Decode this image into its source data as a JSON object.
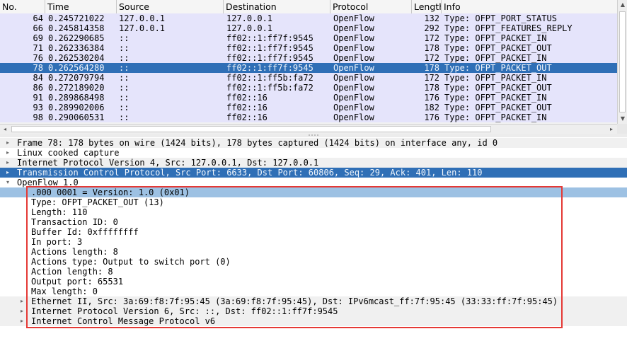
{
  "packet_list": {
    "columns": [
      "No.",
      "Time",
      "Source",
      "Destination",
      "Protocol",
      "Length",
      "Info"
    ],
    "rows": [
      {
        "no": "64",
        "time": "0.245721022",
        "src": "127.0.0.1",
        "dst": "127.0.0.1",
        "proto": "OpenFlow",
        "len": "132",
        "info": "Type: OFPT_PORT_STATUS",
        "selected": false
      },
      {
        "no": "66",
        "time": "0.245814358",
        "src": "127.0.0.1",
        "dst": "127.0.0.1",
        "proto": "OpenFlow",
        "len": "292",
        "info": "Type: OFPT_FEATURES_REPLY",
        "selected": false
      },
      {
        "no": "69",
        "time": "0.262290685",
        "src": "::",
        "dst": "ff02::1:ff7f:9545",
        "proto": "OpenFlow",
        "len": "172",
        "info": "Type: OFPT_PACKET_IN",
        "selected": false
      },
      {
        "no": "71",
        "time": "0.262336384",
        "src": "::",
        "dst": "ff02::1:ff7f:9545",
        "proto": "OpenFlow",
        "len": "178",
        "info": "Type: OFPT_PACKET_OUT",
        "selected": false
      },
      {
        "no": "76",
        "time": "0.262530204",
        "src": "::",
        "dst": "ff02::1:ff7f:9545",
        "proto": "OpenFlow",
        "len": "172",
        "info": "Type: OFPT_PACKET_IN",
        "selected": false
      },
      {
        "no": "78",
        "time": "0.262564280",
        "src": "::",
        "dst": "ff02::1:ff7f:9545",
        "proto": "OpenFlow",
        "len": "178",
        "info": "Type: OFPT_PACKET_OUT",
        "selected": true
      },
      {
        "no": "84",
        "time": "0.272079794",
        "src": "::",
        "dst": "ff02::1:ff5b:fa72",
        "proto": "OpenFlow",
        "len": "172",
        "info": "Type: OFPT_PACKET_IN",
        "selected": false
      },
      {
        "no": "86",
        "time": "0.272189020",
        "src": "::",
        "dst": "ff02::1:ff5b:fa72",
        "proto": "OpenFlow",
        "len": "178",
        "info": "Type: OFPT_PACKET_OUT",
        "selected": false
      },
      {
        "no": "91",
        "time": "0.289868498",
        "src": "::",
        "dst": "ff02::16",
        "proto": "OpenFlow",
        "len": "176",
        "info": "Type: OFPT_PACKET_IN",
        "selected": false
      },
      {
        "no": "93",
        "time": "0.289902006",
        "src": "::",
        "dst": "ff02::16",
        "proto": "OpenFlow",
        "len": "182",
        "info": "Type: OFPT_PACKET_OUT",
        "selected": false
      },
      {
        "no": "98",
        "time": "0.290060531",
        "src": "::",
        "dst": "ff02::16",
        "proto": "OpenFlow",
        "len": "176",
        "info": "Type: OFPT_PACKET_IN",
        "selected": false
      }
    ]
  },
  "details": [
    {
      "text": "Frame 78: 178 bytes on wire (1424 bits), 178 bytes captured (1424 bits) on interface any, id 0",
      "level": 0,
      "expander": "collapsed",
      "style": "alt"
    },
    {
      "text": "Linux cooked capture",
      "level": 0,
      "expander": "collapsed",
      "style": "plain"
    },
    {
      "text": "Internet Protocol Version 4, Src: 127.0.0.1, Dst: 127.0.0.1",
      "level": 0,
      "expander": "collapsed",
      "style": "alt"
    },
    {
      "text": "Transmission Control Protocol, Src Port: 6633, Dst Port: 60806, Seq: 29, Ack: 401, Len: 110",
      "level": 0,
      "expander": "collapsed",
      "style": "sel"
    },
    {
      "text": "OpenFlow 1.0",
      "level": 0,
      "expander": "expanded",
      "style": "plain"
    },
    {
      "text": ".000 0001 = Version: 1.0 (0x01)",
      "level": 1,
      "expander": "none",
      "style": "subsel"
    },
    {
      "text": "Type: OFPT_PACKET_OUT (13)",
      "level": 1,
      "expander": "none",
      "style": "sub"
    },
    {
      "text": "Length: 110",
      "level": 1,
      "expander": "none",
      "style": "sub"
    },
    {
      "text": "Transaction ID: 0",
      "level": 1,
      "expander": "none",
      "style": "sub"
    },
    {
      "text": "Buffer Id: 0xffffffff",
      "level": 1,
      "expander": "none",
      "style": "sub"
    },
    {
      "text": "In port: 3",
      "level": 1,
      "expander": "none",
      "style": "sub"
    },
    {
      "text": "Actions length: 8",
      "level": 1,
      "expander": "none",
      "style": "sub"
    },
    {
      "text": "Actions type: Output to switch port (0)",
      "level": 1,
      "expander": "none",
      "style": "sub"
    },
    {
      "text": "Action length: 8",
      "level": 1,
      "expander": "none",
      "style": "sub"
    },
    {
      "text": "Output port: 65531",
      "level": 1,
      "expander": "none",
      "style": "sub"
    },
    {
      "text": "Max length: 0",
      "level": 1,
      "expander": "none",
      "style": "sub"
    },
    {
      "text": "Ethernet II, Src: 3a:69:f8:7f:95:45 (3a:69:f8:7f:95:45), Dst: IPv6mcast_ff:7f:95:45 (33:33:ff:7f:95:45)",
      "level": 1,
      "expander": "collapsed",
      "style": "alt"
    },
    {
      "text": "Internet Protocol Version 6, Src: ::, Dst: ff02::1:ff7f:9545",
      "level": 1,
      "expander": "collapsed",
      "style": "alt"
    },
    {
      "text": "Internet Control Message Protocol v6",
      "level": 1,
      "expander": "collapsed",
      "style": "alt"
    }
  ],
  "icons": {
    "collapsed": "▸",
    "expanded": "▾",
    "scroll_up": "▲",
    "scroll_down": "▼",
    "scroll_left": "◂",
    "scroll_right": "▸"
  },
  "colors": {
    "row_bg": "#e5e4fb",
    "selection": "#2f6fb6",
    "sub_selection": "#9dc1e3",
    "highlight_box": "#e53935"
  }
}
